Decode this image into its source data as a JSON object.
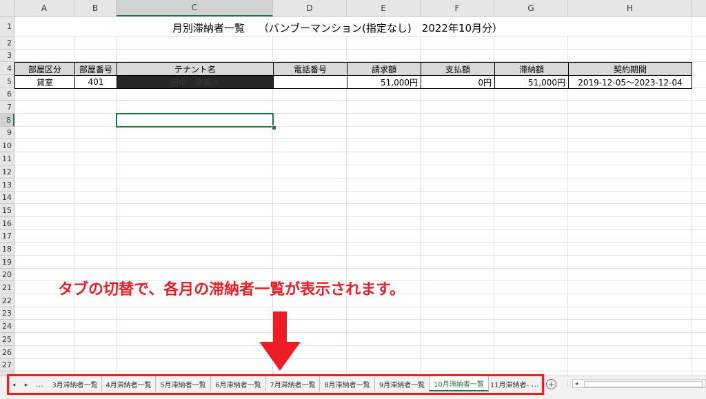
{
  "columns": [
    "A",
    "B",
    "C",
    "D",
    "E",
    "F",
    "G",
    "H"
  ],
  "rows": [
    "1",
    "2",
    "3",
    "4",
    "5",
    "6",
    "7",
    "8",
    "9",
    "10",
    "11",
    "12",
    "13",
    "14",
    "15",
    "16",
    "17",
    "18",
    "19",
    "20",
    "21",
    "22",
    "23",
    "24",
    "25",
    "26",
    "27"
  ],
  "selected_column": "C",
  "selected_row": "8",
  "title": "月別滞納者一覧　 （バンブーマンション(指定なし)　2022年10月分）",
  "table": {
    "headers": [
      "部屋区分",
      "部屋番号",
      "テナント名",
      "電話番号",
      "請求額",
      "支払額",
      "滞納額",
      "契約期間"
    ],
    "row": [
      "貸室",
      "401",
      "田中　摩美々",
      "",
      "51,000円",
      "0円",
      "51,000円",
      "2019-12-05～2023-12-04"
    ]
  },
  "annotation": "タブの切替で、各月の滞納者一覧が表示されます。",
  "tabs": {
    "prev": "◂",
    "next": "▸",
    "more_left": "...",
    "items": [
      "3月滞納者一覧",
      "4月滞納者一覧",
      "5月滞納者一覧",
      "6月滞納者一覧",
      "7月滞納者一覧",
      "8月滞納者一覧",
      "9月滞納者一覧",
      "10月滞納者一覧",
      "11月滞納者-"
    ],
    "active": "10月滞納者一覧",
    "more_right": "...",
    "add": "+"
  },
  "colors": {
    "annotation": "#ee1c25",
    "accent": "#217346",
    "header_fill": "#d9d9d9",
    "name_cell": "#262626"
  }
}
